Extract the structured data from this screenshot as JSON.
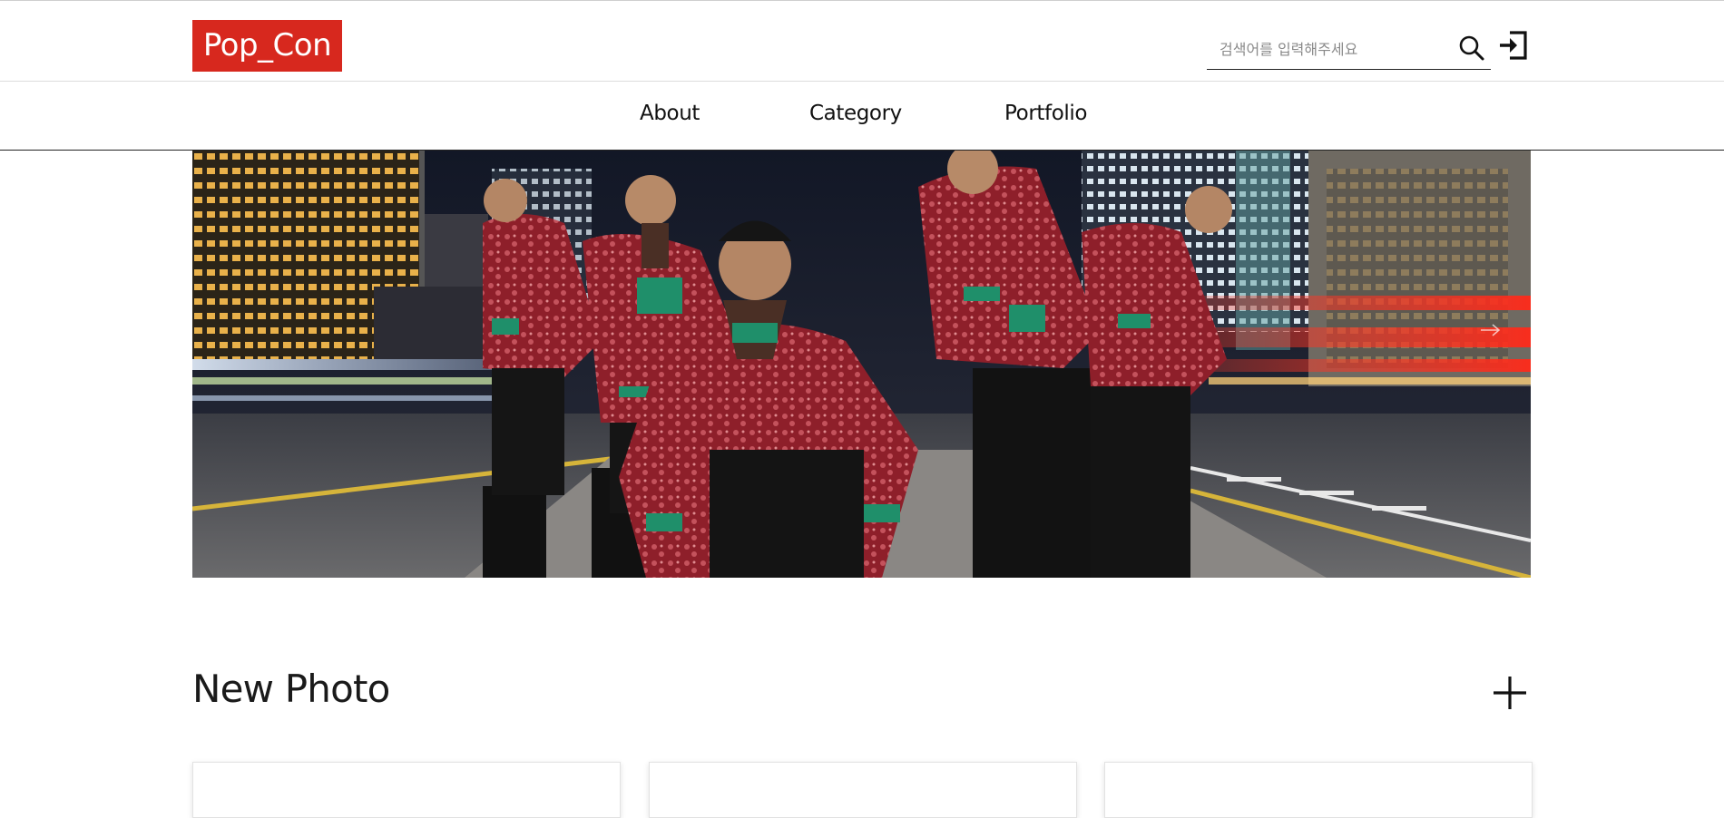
{
  "header": {
    "logo_text": "Pop_Con",
    "search": {
      "placeholder": "검색어를 입력해주세요",
      "icon": "search-icon"
    },
    "login_icon": "sign-in-icon"
  },
  "nav": {
    "items": [
      {
        "label": "About"
      },
      {
        "label": "Category"
      },
      {
        "label": "Portfolio"
      }
    ]
  },
  "hero": {
    "image_icon": "hero-photo",
    "colors": {
      "accent_red": "#d7281e",
      "jacket_red": "#8e1f2a",
      "sleeve_green": "#1f8f6a"
    }
  },
  "new_photo": {
    "title": "New Photo",
    "more_icon": "plus-icon",
    "cards": [
      {},
      {},
      {}
    ]
  }
}
